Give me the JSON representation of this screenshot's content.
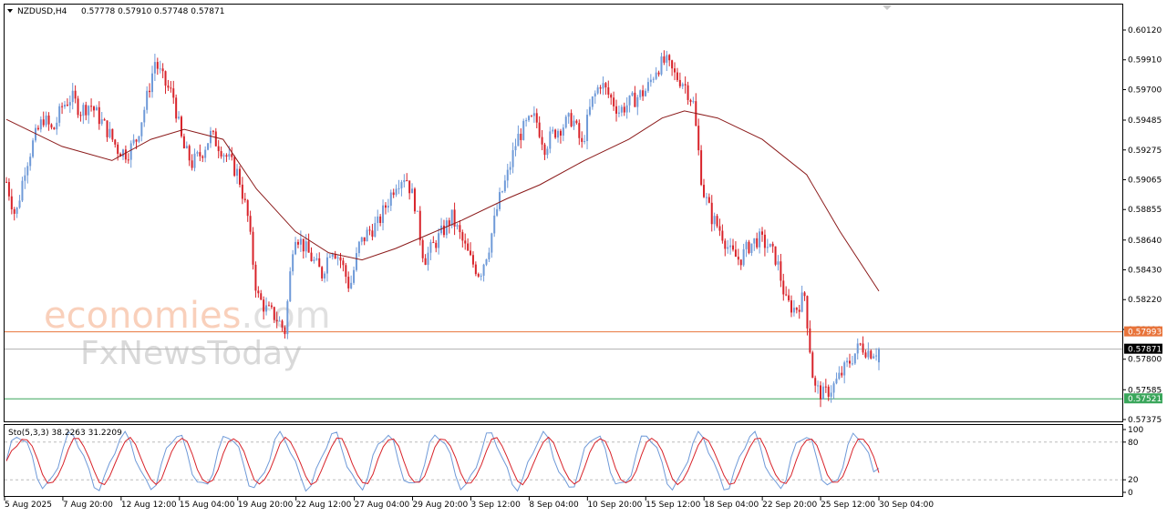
{
  "header": {
    "symbol": "NZDUSD,H4",
    "ohlc": "0.57778 0.57910 0.57748 0.57871"
  },
  "watermark": {
    "line1_colored": "economies",
    "line1_grey": ".com",
    "line2": "FxNewsToday"
  },
  "colors": {
    "bull": "#6f9ad8",
    "bear": "#d8232a",
    "ma": "#8b1a1a",
    "resistance": "#e8743b",
    "support": "#3aa65b",
    "current": "#b0b0b0",
    "stoch_main": "#6f9ad8",
    "stoch_signal": "#d8232a"
  },
  "chart_data": {
    "type": "candlestick",
    "symbol": "NZDUSD",
    "timeframe": "H4",
    "ylim": [
      0.57375,
      0.60225
    ],
    "y_ticks": [
      "0.60120",
      "0.59910",
      "0.59700",
      "0.59485",
      "0.59275",
      "0.59065",
      "0.58855",
      "0.58640",
      "0.58430",
      "0.58220",
      "0.58010",
      "0.57800",
      "0.57585",
      "0.57375"
    ],
    "x_ticks": [
      "5 Aug 2025",
      "7 Aug 20:00",
      "12 Aug 12:00",
      "15 Aug 04:00",
      "19 Aug 20:00",
      "22 Aug 12:00",
      "27 Aug 04:00",
      "29 Aug 20:00",
      "3 Sep 12:00",
      "8 Sep 04:00",
      "10 Sep 20:00",
      "15 Sep 12:00",
      "18 Sep 04:00",
      "22 Sep 20:00",
      "25 Sep 12:00",
      "30 Sep 04:00"
    ],
    "close_path": [
      0.5905,
      0.588,
      0.5915,
      0.5935,
      0.595,
      0.594,
      0.5958,
      0.5965,
      0.5955,
      0.596,
      0.595,
      0.594,
      0.5928,
      0.5925,
      0.5935,
      0.596,
      0.599,
      0.5975,
      0.5965,
      0.593,
      0.5918,
      0.5925,
      0.5938,
      0.593,
      0.592,
      0.591,
      0.588,
      0.5825,
      0.5815,
      0.581,
      0.58,
      0.587,
      0.586,
      0.585,
      0.584,
      0.586,
      0.585,
      0.583,
      0.586,
      0.587,
      0.5875,
      0.589,
      0.5905,
      0.591,
      0.589,
      0.585,
      0.586,
      0.587,
      0.588,
      0.5865,
      0.585,
      0.584,
      0.586,
      0.589,
      0.591,
      0.5935,
      0.5945,
      0.595,
      0.593,
      0.594,
      0.5945,
      0.595,
      0.593,
      0.596,
      0.5975,
      0.5965,
      0.5955,
      0.596,
      0.5965,
      0.597,
      0.5985,
      0.599,
      0.598,
      0.5975,
      0.596,
      0.59,
      0.588,
      0.587,
      0.5855,
      0.585,
      0.586,
      0.5865,
      0.586,
      0.585,
      0.582,
      0.5815,
      0.5825,
      0.576,
      0.5755,
      0.576,
      0.577,
      0.578,
      0.579,
      0.5785,
      0.5787
    ],
    "moving_average": [
      [
        0,
        0.5949
      ],
      [
        0.1,
        0.593
      ],
      [
        0.19,
        0.592
      ],
      [
        0.26,
        0.5935
      ],
      [
        0.32,
        0.5942
      ],
      [
        0.39,
        0.5935
      ],
      [
        0.45,
        0.59
      ],
      [
        0.52,
        0.587
      ],
      [
        0.58,
        0.5855
      ],
      [
        0.64,
        0.585
      ],
      [
        0.7,
        0.5858
      ],
      [
        0.76,
        0.5868
      ],
      [
        0.82,
        0.5878
      ],
      [
        0.9,
        0.5893
      ],
      [
        0.96,
        0.5903
      ],
      [
        1.04,
        0.592
      ],
      [
        1.12,
        0.5935
      ],
      [
        1.18,
        0.595
      ],
      [
        1.22,
        0.5955
      ],
      [
        1.28,
        0.595
      ],
      [
        1.36,
        0.5935
      ],
      [
        1.44,
        0.591
      ],
      [
        1.5,
        0.587
      ],
      [
        1.57,
        0.5828
      ]
    ],
    "levels": [
      {
        "label": "0.57993",
        "value": 0.57993,
        "role": "resistance"
      },
      {
        "label": "0.57871",
        "value": 0.57871,
        "role": "current"
      },
      {
        "label": "0.57521",
        "value": 0.57521,
        "role": "support"
      }
    ],
    "stochastic": {
      "label": "Sto(5,3,3) 38.2263 31.2209",
      "main": 38.2263,
      "signal": 31.2209,
      "ylim": [
        0,
        100
      ],
      "y_ticks": [
        "100",
        "80",
        "20",
        "0"
      ],
      "levels": [
        20,
        80
      ]
    }
  }
}
